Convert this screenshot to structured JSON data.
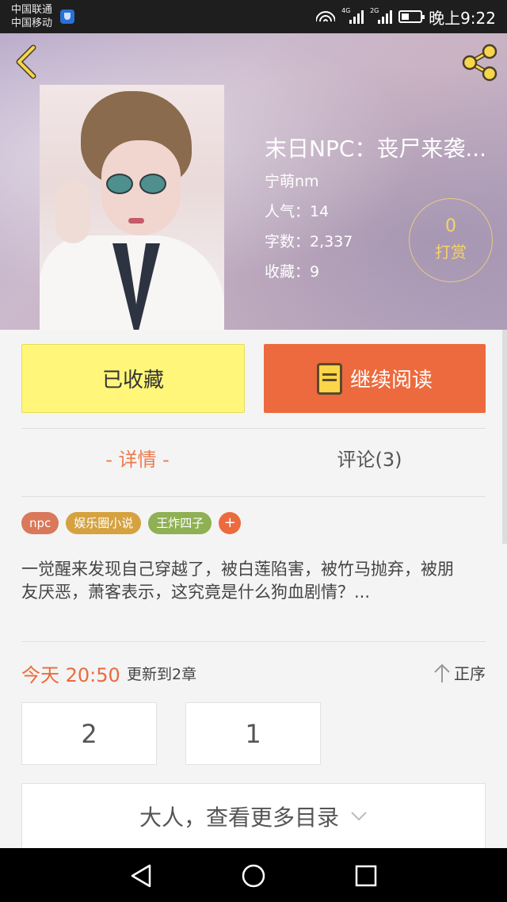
{
  "status_bar": {
    "carrier1": "中国联通",
    "carrier2": "中国移动",
    "net1": "4G",
    "net2": "2G",
    "time": "晚上9:22"
  },
  "header": {
    "back_icon": "chevron-left-icon",
    "share_icon": "share-icon"
  },
  "book": {
    "title": "末日NPC：丧尸来袭...",
    "author": "宁萌nm",
    "popularity": "人气：14",
    "word_count": "字数：2,337",
    "favorites": "收藏：9",
    "tip_count": "0",
    "tip_label": "打赏"
  },
  "actions": {
    "collected_label": "已收藏",
    "read_label": "继续阅读",
    "read_icon": "book-icon"
  },
  "tabs": {
    "detail": "- 详情 -",
    "comments": "评论(3)"
  },
  "tags": [
    {
      "label": "npc",
      "color": "#d9785b"
    },
    {
      "label": "娱乐圈小说",
      "color": "#d5a23f"
    },
    {
      "label": "王炸四子",
      "color": "#8fb053"
    }
  ],
  "tag_add": "+",
  "summary": "一觉醒来发现自己穿越了，被白莲陷害，被竹马抛弃，被朋友厌恶，萧客表示，这究竟是什么狗血剧情？...",
  "update": {
    "time": "今天 20:50",
    "text": "更新到2章",
    "order_label": "正序"
  },
  "chapters": [
    "2",
    "1"
  ],
  "more_catalog": "大人，查看更多目录",
  "colors": {
    "accent": "#ec6a3d",
    "collected_bg": "#fff67a",
    "tip_gold": "#f5d36a"
  }
}
